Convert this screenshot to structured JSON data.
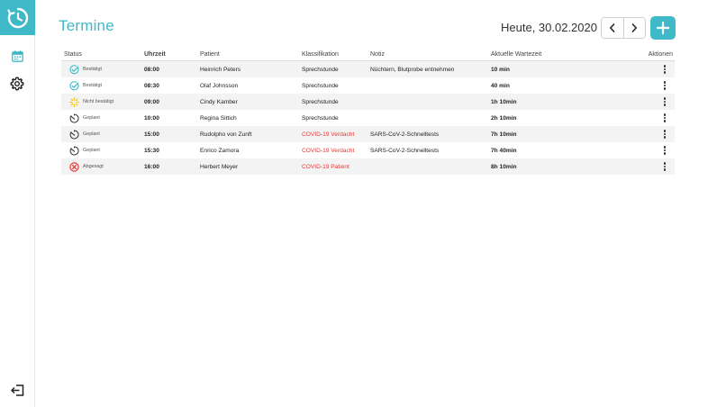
{
  "header": {
    "title": "Termine",
    "date": "Heute, 30.02.2020"
  },
  "sidebar": {
    "items": [
      {
        "icon": "calendar-icon"
      },
      {
        "icon": "gear-icon"
      },
      {
        "icon": "logout-icon"
      }
    ]
  },
  "colors": {
    "accent": "#3fb9c8",
    "warning": "#f5c518",
    "danger": "#e53935"
  },
  "table": {
    "columns": [
      "Status",
      "Uhrzeit",
      "Patient",
      "Klassifikation",
      "Notiz",
      "Aktuelle Wartezeit",
      "Aktionen"
    ],
    "rows": [
      {
        "status": "Bestätigt",
        "icon": "check-circle-icon",
        "time": "08:00",
        "patient": "Heinrich Peters",
        "class": "Sprechstunde",
        "note": "Nüchtern, Blutprobe entnehmen",
        "wait": "10 min"
      },
      {
        "status": "Bestätigt",
        "icon": "check-circle-icon",
        "time": "08:30",
        "patient": "Olaf Johnsson",
        "class": "Sprechstunde",
        "note": "",
        "wait": "40 min"
      },
      {
        "status": "Nicht bestätigt",
        "icon": "loading-icon",
        "time": "09:00",
        "patient": "Cindy Kamber",
        "class": "Sprechstunde",
        "note": "",
        "wait": "1h 10min"
      },
      {
        "status": "Geplant",
        "icon": "timer-icon",
        "time": "10:00",
        "patient": "Regina Sittich",
        "class": "Sprechstunde",
        "note": "",
        "wait": "2h 10min"
      },
      {
        "status": "Geplant",
        "icon": "timer-icon",
        "time": "15:00",
        "patient": "Rudolpho von Zunft",
        "class": "COVID-19 Verdacht",
        "note": "SARS-CoV-2-Schnelltests",
        "wait": "7h 10min"
      },
      {
        "status": "Geplant",
        "icon": "timer-icon",
        "time": "15:30",
        "patient": "Enrico Zamora",
        "class": "COVID-19 Verdacht",
        "note": "SARS-CoV-2-Schnelltests",
        "wait": "7h 40min"
      },
      {
        "status": "Abgesagt",
        "icon": "cancel-circle-icon",
        "time": "16:00",
        "patient": "Herbert Meyer",
        "class": "COVID-19 Patient",
        "note": "",
        "wait": "8h 10min"
      }
    ]
  }
}
